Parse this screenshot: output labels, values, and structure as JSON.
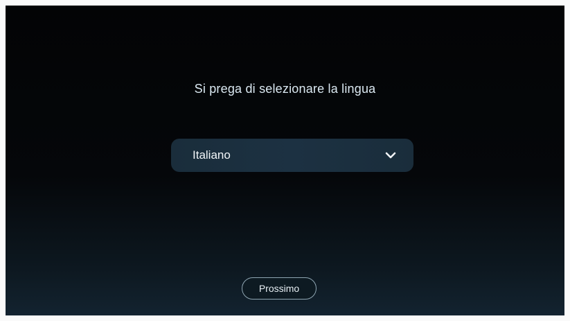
{
  "prompt": {
    "text": "Si prega di selezionare la lingua"
  },
  "language_select": {
    "selected": "Italiano",
    "icon": "chevron-down-icon"
  },
  "next_button": {
    "label": "Prossimo"
  },
  "colors": {
    "background": "#05070a",
    "select_background": "#1c3142",
    "text": "#dbe9f2",
    "button_border": "#8fa6b3"
  }
}
